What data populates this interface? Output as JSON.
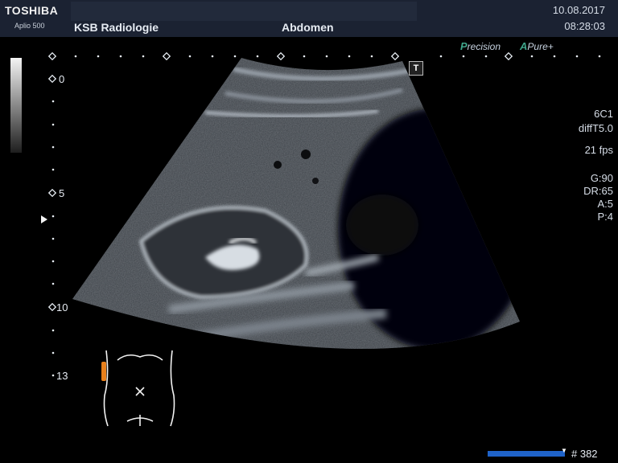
{
  "header": {
    "brand": "TOSHIBA",
    "model": "Aplio 500",
    "institution": "KSB Radiologie",
    "preset": "Abdomen",
    "date": "10.08.2017",
    "time": "08:28:03"
  },
  "logos": {
    "precision_first": "P",
    "precision_rest": "recision",
    "pure_first": "A",
    "pure_rest": "Pure",
    "pure_plus": "+"
  },
  "t_badge": "T",
  "depth_scale": {
    "label_0": "0",
    "label_5": "5",
    "label_10": "10",
    "label_13": "13"
  },
  "params": {
    "probe": "6C1",
    "mode": "diffT5.0",
    "fps": "21 fps",
    "gain": "G:90",
    "dynamic_range": "DR:65",
    "a": "A:5",
    "p": "P:4"
  },
  "frame_counter": "# 382",
  "colors": {
    "header_bg": "#1b2232",
    "logo_accent": "#3fa48a",
    "bodymark_probe": "#e8801c",
    "frame_bar": "#1f63c9"
  }
}
